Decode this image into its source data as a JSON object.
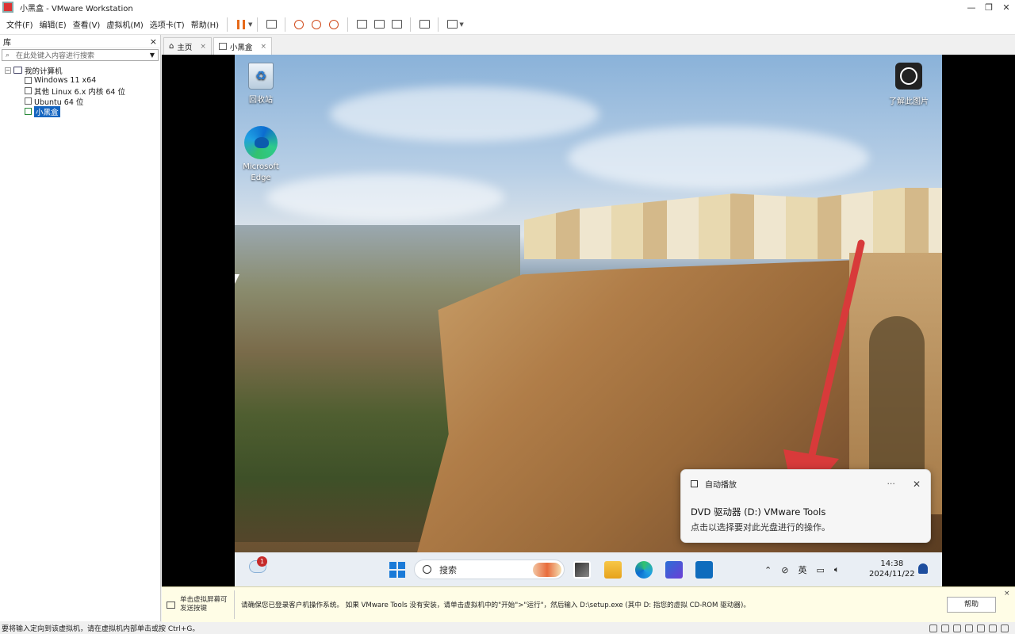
{
  "window": {
    "title": "小黑盒 - VMware Workstation",
    "minimize": "—",
    "restore": "❐",
    "close": "✕"
  },
  "menu": {
    "items": [
      "文件(F)",
      "编辑(E)",
      "查看(V)",
      "虚拟机(M)",
      "选项卡(T)",
      "帮助(H)"
    ]
  },
  "library": {
    "title": "库",
    "close": "×",
    "search_placeholder": "在此处键入内容进行搜索",
    "root": "我的计算机",
    "items": [
      "Windows 11 x64",
      "其他 Linux 6.x 内核 64 位",
      "Ubuntu 64 位",
      "小黑盒"
    ],
    "selected": "小黑盒"
  },
  "tabs": [
    {
      "label": "主页",
      "close": "×"
    },
    {
      "label": "小黑盒",
      "close": "×"
    }
  ],
  "desktop": {
    "icons": [
      {
        "label": "回收站"
      },
      {
        "label": "Microsoft Edge"
      },
      {
        "label": "了解此图片"
      }
    ]
  },
  "toast": {
    "app": "自动播放",
    "more": "···",
    "close": "✕",
    "title": "DVD 驱动器 (D:) VMware Tools",
    "description": "点击以选择要对此光盘进行的操作。"
  },
  "taskbar": {
    "weather_badge": "1",
    "search_label": "搜索",
    "ime": "英",
    "time": "14:38",
    "date": "2024/11/22"
  },
  "infobar": {
    "hint": "单击虚拟屏幕可发送按键",
    "message": "请确保您已登录客户机操作系统。 如果 VMware Tools 没有安装，请单击虚拟机中的\"开始\">\"运行\"，然后输入 D:\\setup.exe (其中 D: 指您的虚拟 CD-ROM 驱动器)。",
    "help": "帮助",
    "close": "×"
  },
  "statusbar": {
    "text": "要将输入定向到该虚拟机，请在虚拟机内部单击或按 Ctrl+G。"
  },
  "colors": {
    "accent": "#1565c0",
    "pause": "#e66a1a",
    "arrow": "#d83a3a",
    "info_bg": "#fffde6"
  }
}
